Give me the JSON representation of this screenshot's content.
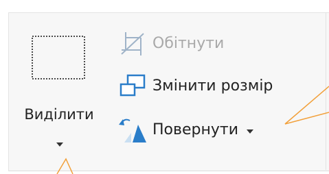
{
  "image_group": {
    "select": {
      "label": "Виділити",
      "icon": "dashed-rectangle-selection-icon",
      "dropdown_icon": "caret-down-icon"
    },
    "crop": {
      "label": "Обітнути",
      "icon": "crop-icon",
      "enabled": false
    },
    "resize": {
      "label": "Змінити розмір",
      "icon": "resize-icon"
    },
    "rotate": {
      "label": "Повернути",
      "icon": "rotate-icon",
      "dropdown_icon": "caret-down-icon"
    }
  },
  "colors": {
    "accent_blue": "#2a7dc9",
    "disabled_text": "#a9a9a9",
    "annotation_orange": "#f2a03a",
    "group_background": "#f7f7f7"
  }
}
